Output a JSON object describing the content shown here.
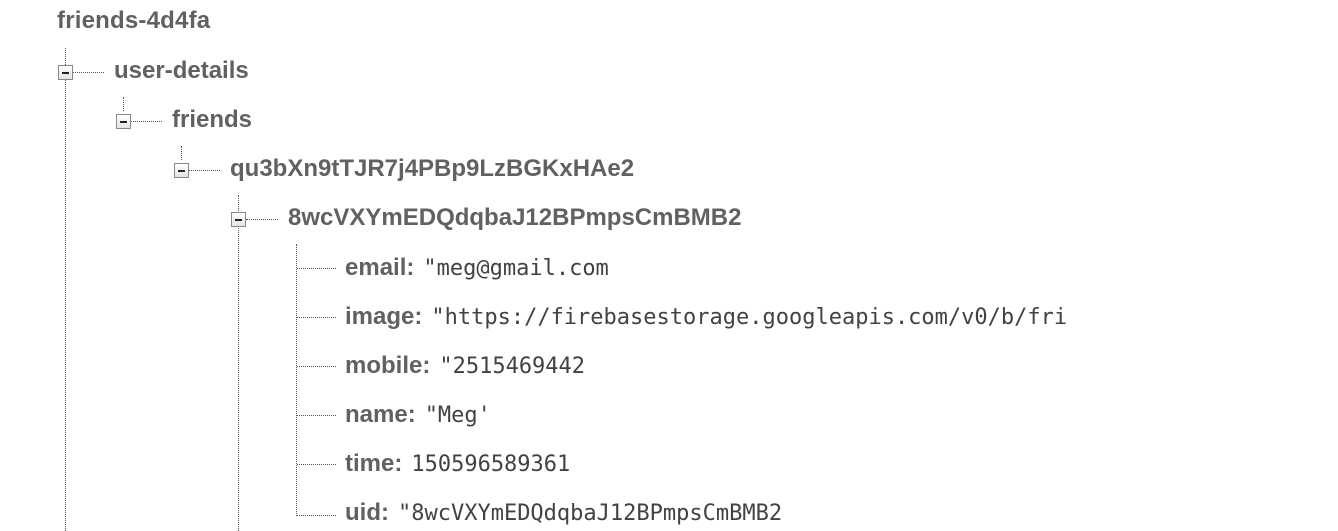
{
  "tree": {
    "root": "friends-4d4fa",
    "level1": "user-details",
    "level2": "friends",
    "level3": "qu3bXn9tTJR7j4PBp9LzBGKxHAe2",
    "level4": "8wcVXYmEDQdqbaJ12BPmpsCmBMB2",
    "fields": [
      {
        "key": "email:",
        "value": "\"meg@gmail.com"
      },
      {
        "key": "image:",
        "value": "\"https://firebasestorage.googleapis.com/v0/b/fri"
      },
      {
        "key": "mobile:",
        "value": "\"2515469442"
      },
      {
        "key": "name:",
        "value": "\"Meg'"
      },
      {
        "key": "time:",
        "value": "150596589361"
      },
      {
        "key": "uid:",
        "value": "\"8wcVXYmEDQdqbaJ12BPmpsCmBMB2"
      }
    ]
  },
  "icons": {
    "collapse": "minus-box-icon"
  }
}
